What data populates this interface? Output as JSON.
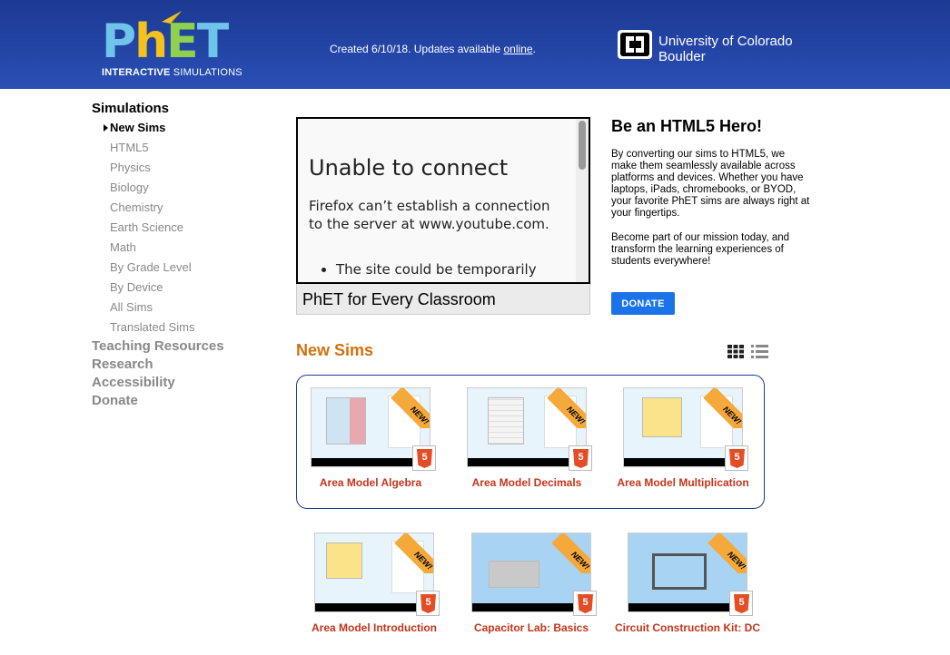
{
  "header": {
    "logo_text": "PhET",
    "logo_sub_bold": "INTERACTIVE",
    "logo_sub": " SIMULATIONS",
    "created_text": "Created 6/10/18. Updates available ",
    "online_link": "online",
    "created_suffix": ".",
    "university_line1": "University of Colorado",
    "university_line2": "Boulder",
    "header_color": "#2446a8"
  },
  "sidebar": {
    "title": "Simulations",
    "sub_items": [
      {
        "label": "New Sims",
        "active": true
      },
      {
        "label": "HTML5"
      },
      {
        "label": "Physics"
      },
      {
        "label": "Biology"
      },
      {
        "label": "Chemistry"
      },
      {
        "label": "Earth Science"
      },
      {
        "label": "Math"
      },
      {
        "label": "By Grade Level"
      },
      {
        "label": "By Device"
      },
      {
        "label": "All Sims"
      },
      {
        "label": "Translated Sims"
      }
    ],
    "main_items": [
      "Teaching Resources",
      "Research",
      "Accessibility",
      "Donate"
    ]
  },
  "video": {
    "error_title": "Unable to connect",
    "error_message": "Firefox can’t establish a connection to the server at www.youtube.com.",
    "bullet": "The site could be temporarily",
    "caption": "PhET for Every Classroom"
  },
  "hero": {
    "title": "Be an HTML5 Hero!",
    "paragraph1": "By converting our sims to HTML5, we make them seamlessly available across platforms and devices. Whether you have laptops, iPads, chromebooks, or BYOD, your favorite PhET sims are always right at your fingertips.",
    "paragraph2": "Become part of our mission today, and transform the learning experiences of students everywhere!",
    "donate_label": "DONATE",
    "donate_color": "#1a73e8"
  },
  "new_sims": {
    "title": "New Sims",
    "title_color": "#d3700d",
    "badge_text": "NEW!",
    "html5_label": "5",
    "featured": [
      {
        "name": "Area Model Algebra"
      },
      {
        "name": "Area Model Decimals"
      },
      {
        "name": "Area Model Multiplication"
      }
    ],
    "others": [
      {
        "name": "Area Model Introduction"
      },
      {
        "name": "Capacitor Lab: Basics"
      },
      {
        "name": "Circuit Construction Kit: DC"
      }
    ]
  }
}
